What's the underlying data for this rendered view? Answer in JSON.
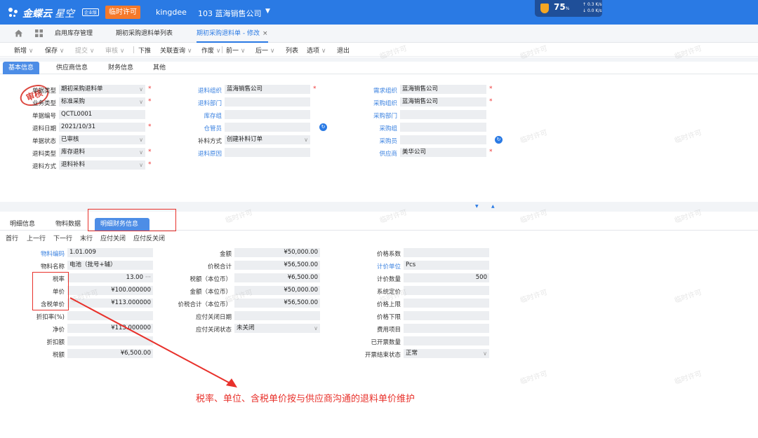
{
  "app": {
    "brand": "金蝶云",
    "brand_sub": "星空",
    "brand_tag": "企业版",
    "temp_license": "临时许可",
    "user": "kingdee",
    "org": "103  蓝海销售公司",
    "perf_pct": "75",
    "perf_unit": "%",
    "speed_up": "0.3 K/s",
    "speed_down": "0.0 K/s"
  },
  "tabs": [
    {
      "label": "启用库存管理"
    },
    {
      "label": "期初采购退料单列表"
    },
    {
      "label": "期初采购退料单 - 修改",
      "close": "×"
    }
  ],
  "toolbar": [
    "新增",
    "保存",
    "提交",
    "审核",
    "下推",
    "关联查询",
    "作废",
    "前一",
    "后一",
    "列表",
    "选项",
    "退出"
  ],
  "toolbar_dropdown_caret": "∨",
  "head_tabs": [
    "基本信息",
    "供应商信息",
    "财务信息",
    "其他"
  ],
  "head_col1": [
    {
      "label": "单据类型",
      "value": "期初采购退料单"
    },
    {
      "label": "业务类型",
      "value": "标准采购"
    },
    {
      "label": "单据编号",
      "value": "QCTL0001"
    },
    {
      "label": "退料日期",
      "value": "2021/10/31"
    },
    {
      "label": "单据状态",
      "value": "已审核"
    },
    {
      "label": "退料类型",
      "value": "库存退料"
    },
    {
      "label": "退料方式",
      "value": "退料补料"
    }
  ],
  "head_col2": [
    {
      "label": "退料组织",
      "value": "蓝海销售公司"
    },
    {
      "label": "退料部门",
      "value": ""
    },
    {
      "label": "库存组",
      "value": ""
    },
    {
      "label": "仓管员",
      "value": ""
    },
    {
      "label": "补料方式",
      "value": "创建补料订单"
    },
    {
      "label": "退料原因",
      "value": ""
    }
  ],
  "head_col3": [
    {
      "label": "需求组织",
      "value": "蓝海销售公司"
    },
    {
      "label": "采购组织",
      "value": "蓝海销售公司"
    },
    {
      "label": "采购部门",
      "value": ""
    },
    {
      "label": "采购组",
      "value": ""
    },
    {
      "label": "采购员",
      "value": ""
    },
    {
      "label": "供应商",
      "value": "美华公司"
    }
  ],
  "stamp": "审核",
  "required_mark": "*",
  "caret_down": "∨",
  "refresh_glyph": "↻",
  "collapse_down": "▼",
  "collapse_up": "▲",
  "detail_tabs": [
    "明细信息",
    "物料数据",
    "明细财务信息"
  ],
  "detail_actions": [
    "首行",
    "上一行",
    "下一行",
    "末行",
    "应付关闭",
    "应付反关闭"
  ],
  "detail_col1": [
    {
      "label": "物料编码",
      "value": "1.01.009"
    },
    {
      "label": "物料名称",
      "value": "电池（批号+辅）"
    },
    {
      "label": "税率",
      "value": "13.00"
    },
    {
      "label": "单价",
      "value": "¥100.000000"
    },
    {
      "label": "含税单价",
      "value": "¥113.000000"
    },
    {
      "label": "折扣率(%)",
      "value": ""
    },
    {
      "label": "净价",
      "value": "¥113.000000"
    },
    {
      "label": "折扣额",
      "value": ""
    },
    {
      "label": "税额",
      "value": "¥6,500.00"
    }
  ],
  "tax_more": "···",
  "detail_col2": [
    {
      "label": "金额",
      "value": "¥50,000.00"
    },
    {
      "label": "价税合计",
      "value": "¥56,500.00"
    },
    {
      "label": "税额（本位币）",
      "value": "¥6,500.00"
    },
    {
      "label": "金额（本位币）",
      "value": "¥50,000.00"
    },
    {
      "label": "价税合计（本位币）",
      "value": "¥56,500.00"
    },
    {
      "label": "应付关闭日期",
      "value": ""
    },
    {
      "label": "应付关闭状态",
      "value": "未关闭"
    }
  ],
  "detail_col3": [
    {
      "label": "价格系数",
      "value": ""
    },
    {
      "label": "计价单位",
      "value": "Pcs"
    },
    {
      "label": "计价数量",
      "value": "500"
    },
    {
      "label": "系统定价",
      "value": ""
    },
    {
      "label": "价格上限",
      "value": ""
    },
    {
      "label": "价格下限",
      "value": ""
    },
    {
      "label": "费用项目",
      "value": ""
    },
    {
      "label": "已开票数量",
      "value": ""
    },
    {
      "label": "开票结束状态",
      "value": "正常"
    }
  ],
  "watermark": "临时许可",
  "annotation": "税率、单位、含税单价按与供应商沟通的退料单价维护",
  "colors": {
    "topbar": "#2a7ae4",
    "accent": "#4d8de6",
    "annotation": "#e8312b",
    "field_bg": "#eceef1"
  }
}
